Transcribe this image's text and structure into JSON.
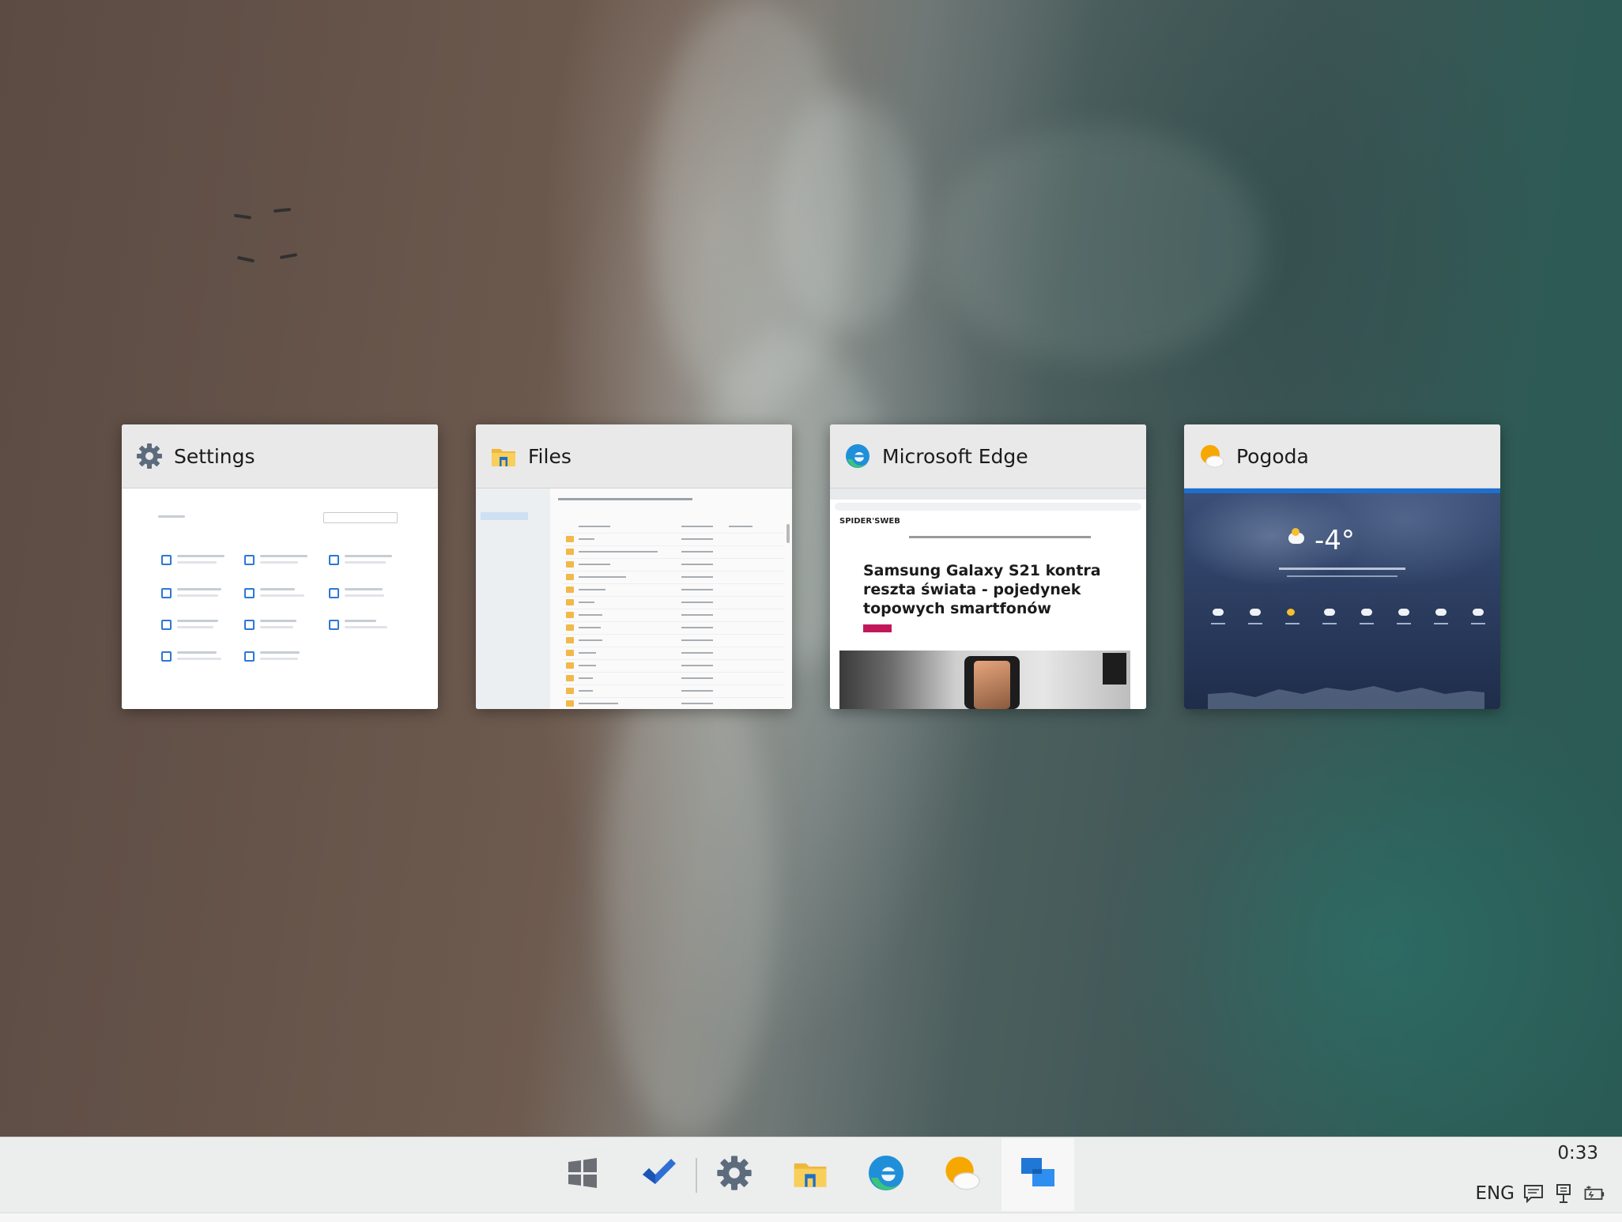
{
  "switcher": {
    "windows": [
      {
        "title": "Settings",
        "icon": "gear-icon"
      },
      {
        "title": "Files",
        "icon": "folder-icon"
      },
      {
        "title": "Microsoft Edge",
        "icon": "edge-icon"
      },
      {
        "title": "Pogoda",
        "icon": "weather-icon"
      }
    ],
    "edge_preview": {
      "site_logo": "SPIDER'SWEB",
      "headline": "Samsung Galaxy S21 kontra reszta świata - pojedynek topowych smartfonów"
    },
    "weather_preview": {
      "temperature": "-4°"
    }
  },
  "taskbar": {
    "items": [
      {
        "name": "start",
        "icon": "windows-logo-icon",
        "active": false
      },
      {
        "name": "todo",
        "icon": "checkmark-icon",
        "active": false
      },
      {
        "name": "settings",
        "icon": "gear-icon",
        "active": false
      },
      {
        "name": "files",
        "icon": "folder-icon",
        "active": false
      },
      {
        "name": "edge",
        "icon": "edge-icon",
        "active": false
      },
      {
        "name": "weather",
        "icon": "weather-icon",
        "active": false
      },
      {
        "name": "task-view",
        "icon": "task-view-icon",
        "active": true
      }
    ],
    "clock": "0:33",
    "language": "ENG",
    "tray_icons": [
      "message-icon",
      "network-icon",
      "battery-icon"
    ]
  },
  "colors": {
    "accent": "#0078d4",
    "taskbar": "#eceded",
    "card_header": "#e9e9e9"
  }
}
